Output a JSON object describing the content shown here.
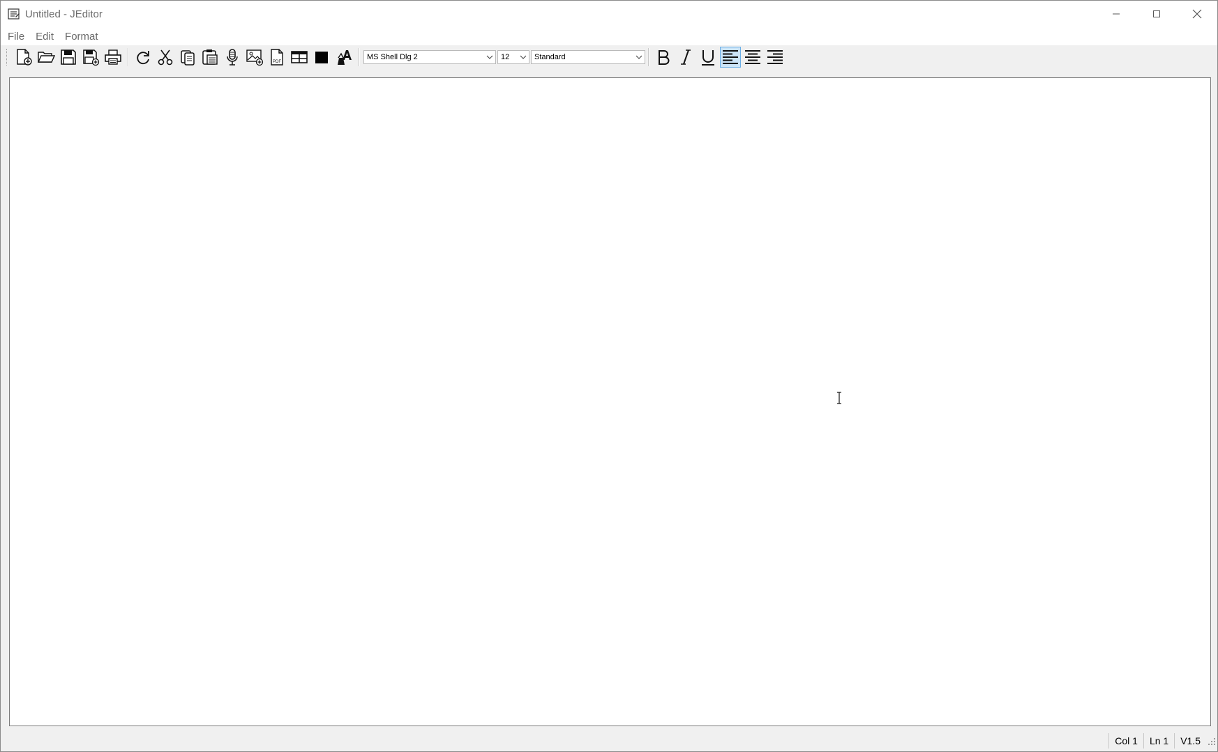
{
  "window": {
    "title": "Untitled - JEditor",
    "controls": [
      "minimize",
      "maximize",
      "close"
    ]
  },
  "menubar": {
    "items": [
      {
        "label": "File"
      },
      {
        "label": "Edit"
      },
      {
        "label": "Format"
      }
    ]
  },
  "toolbar": {
    "buttons": [
      {
        "icon": "new-document-icon"
      },
      {
        "icon": "open-folder-icon"
      },
      {
        "icon": "save-icon"
      },
      {
        "icon": "save-all-icon"
      },
      {
        "icon": "print-icon"
      },
      {
        "icon": "redo-icon"
      },
      {
        "icon": "cut-icon"
      },
      {
        "icon": "copy-icon"
      },
      {
        "icon": "paste-icon"
      },
      {
        "icon": "microphone-icon"
      },
      {
        "icon": "insert-image-icon"
      },
      {
        "icon": "pdf-icon"
      },
      {
        "icon": "table-icon"
      },
      {
        "icon": "color-icon"
      },
      {
        "icon": "font-style-icon"
      }
    ],
    "font_family": "MS Shell Dlg 2",
    "font_size": "12",
    "style": "Standard",
    "format_buttons": [
      {
        "icon": "bold-icon"
      },
      {
        "icon": "italic-icon"
      },
      {
        "icon": "underline-icon"
      },
      {
        "icon": "align-left-icon",
        "active": true
      },
      {
        "icon": "align-center-icon"
      },
      {
        "icon": "align-right-icon"
      }
    ]
  },
  "editor": {
    "content": ""
  },
  "statusbar": {
    "col": "Col 1",
    "line": "Ln 1",
    "version": "V1.5"
  },
  "colors": {
    "active_highlight": "#cce4f7",
    "active_border": "#6aaee6",
    "menu_text": "#6b6b6b"
  }
}
